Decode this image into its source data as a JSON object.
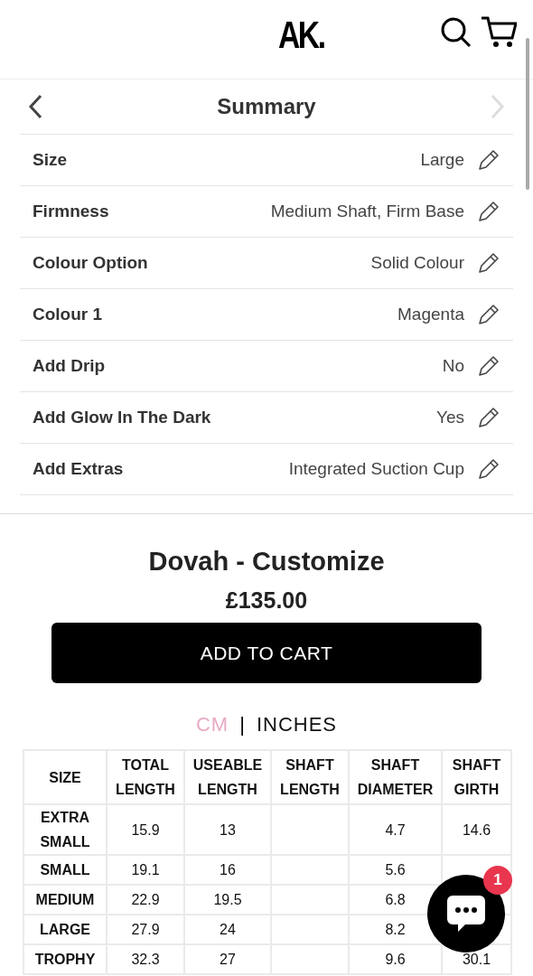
{
  "header": {
    "logo": "AK."
  },
  "summary": {
    "title": "Summary",
    "nav": [
      {
        "kind": "prev",
        "disabled": false
      },
      {
        "kind": "next",
        "disabled": true
      }
    ],
    "rows": [
      {
        "label": "Size",
        "value": "Large"
      },
      {
        "label": "Firmness",
        "value": "Medium Shaft, Firm Base"
      },
      {
        "label": "Colour Option",
        "value": "Solid Colour"
      },
      {
        "label": "Colour 1",
        "value": "Magenta"
      },
      {
        "label": "Add Drip",
        "value": "No"
      },
      {
        "label": "Add Glow In The Dark",
        "value": "Yes"
      },
      {
        "label": "Add Extras",
        "value": "Integrated Suction Cup"
      }
    ]
  },
  "product": {
    "name": "Dovah - Customize",
    "price": "£135.00",
    "button": "ADD TO CART"
  },
  "units": {
    "separator": "|",
    "options": [
      {
        "label": "CM",
        "selected": true
      },
      {
        "label": "INCHES",
        "selected": false
      }
    ]
  },
  "size_table": {
    "columns": [
      "SIZE",
      "TOTAL LENGTH",
      "USEABLE LENGTH",
      "SHAFT LENGTH",
      "SHAFT DIAMETER",
      "SHAFT GIRTH"
    ],
    "rows": [
      [
        "EXTRA SMALL",
        "15.9",
        "13",
        "",
        "4.7",
        "14.6"
      ],
      [
        "SMALL",
        "19.1",
        "16",
        "",
        "5.6",
        ""
      ],
      [
        "MEDIUM",
        "22.9",
        "19.5",
        "",
        "6.8",
        ""
      ],
      [
        "LARGE",
        "27.9",
        "24",
        "",
        "8.2",
        ""
      ],
      [
        "TROPHY",
        "32.3",
        "27",
        "",
        "9.6",
        "30.1"
      ]
    ]
  },
  "chat": {
    "badge": "1"
  }
}
